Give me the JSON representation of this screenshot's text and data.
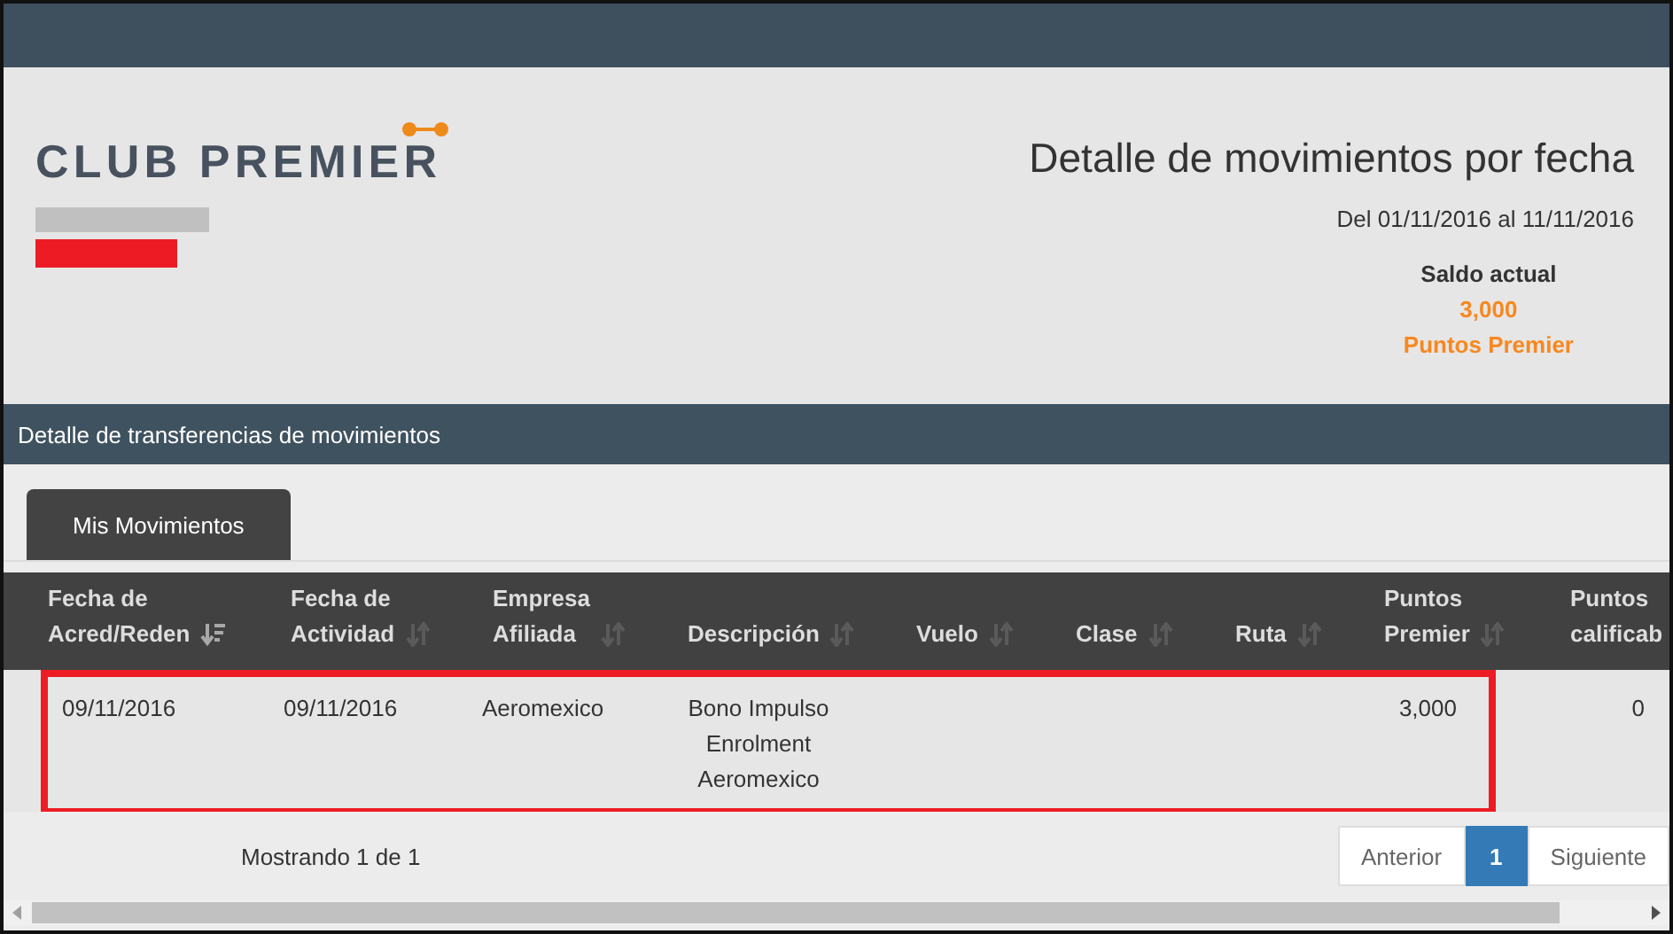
{
  "logo": {
    "text": "CLUB PREMIER"
  },
  "report": {
    "title": "Detalle de movimientos por fecha",
    "range": "Del 01/11/2016 al 11/11/2016",
    "balance_label": "Saldo actual",
    "balance_value": "3,000",
    "balance_unit": "Puntos Premier"
  },
  "section": {
    "title": "Detalle de transferencias de movimientos"
  },
  "tabs": [
    {
      "label": "Mis Movimientos",
      "selected": true
    }
  ],
  "table": {
    "columns": [
      {
        "lines": [
          "Fecha de",
          "Acred/Reden"
        ],
        "sorted": true
      },
      {
        "lines": [
          "Fecha de",
          "Actividad"
        ],
        "sorted": false
      },
      {
        "lines": [
          "Empresa",
          "Afiliada"
        ],
        "sorted": false
      },
      {
        "lines": [
          "Descripción"
        ],
        "sorted": false
      },
      {
        "lines": [
          "Vuelo"
        ],
        "sorted": false
      },
      {
        "lines": [
          "Clase"
        ],
        "sorted": false
      },
      {
        "lines": [
          "Ruta"
        ],
        "sorted": false
      },
      {
        "lines": [
          "Puntos",
          "Premier"
        ],
        "sorted": false
      },
      {
        "lines": [
          "Puntos",
          "calificab"
        ]
      }
    ],
    "rows": [
      {
        "highlighted": true,
        "cells": [
          [
            "09/11/2016"
          ],
          [
            "09/11/2016"
          ],
          [
            "Aeromexico"
          ],
          [
            "Bono Impulso",
            "Enrolment",
            "Aeromexico"
          ],
          [],
          [],
          [],
          [
            "3,000"
          ],
          [
            "0"
          ]
        ]
      }
    ]
  },
  "footer": {
    "info": "Mostrando 1 de 1"
  },
  "pagination": [
    {
      "label": "Anterior",
      "selected": false
    },
    {
      "label": "1",
      "selected": true
    },
    {
      "label": "Siguiente",
      "selected": false
    }
  ]
}
